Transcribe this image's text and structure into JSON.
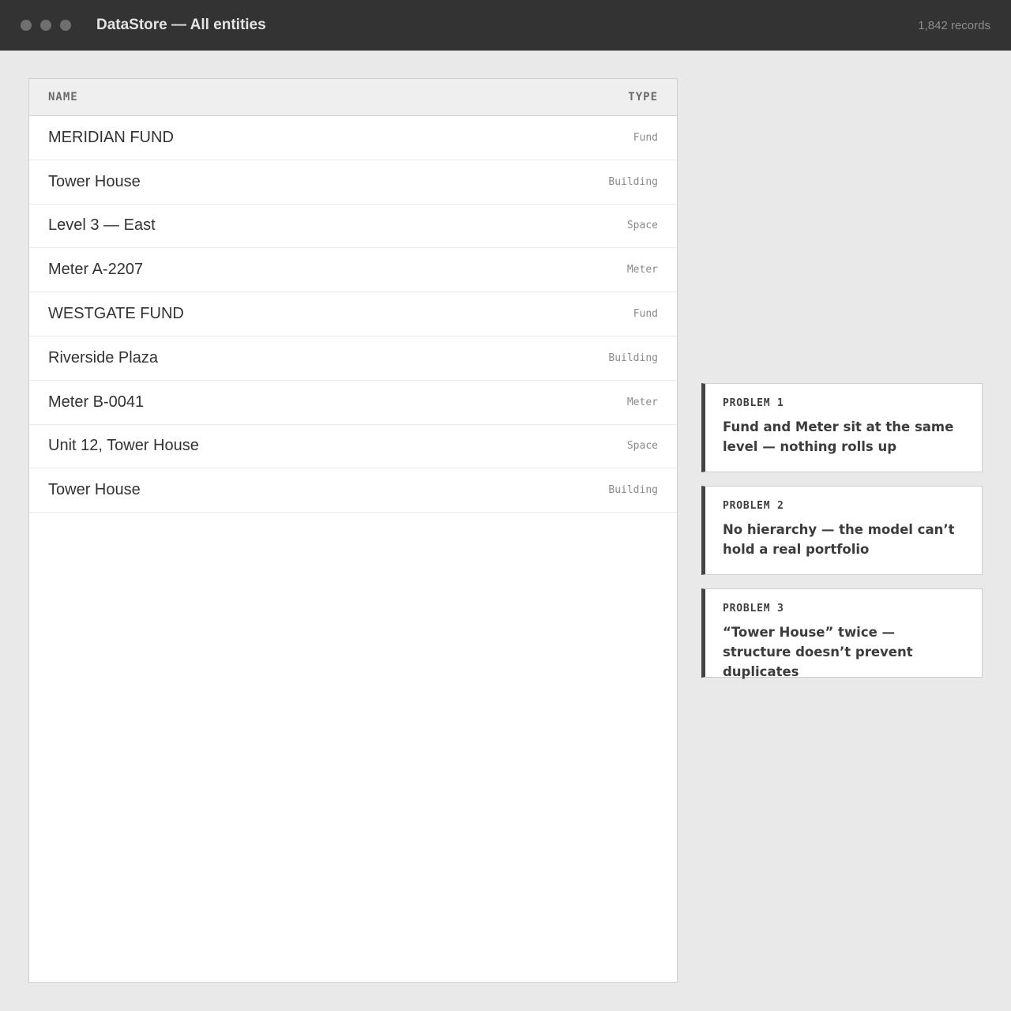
{
  "window": {
    "title": "DataStore — All entities",
    "record_count": "1,842 records",
    "controls": [
      "close-dot",
      "minimize-dot",
      "zoom-dot"
    ]
  },
  "table": {
    "columns": [
      "NAME",
      "TYPE"
    ],
    "rows": [
      {
        "name": "MERIDIAN FUND",
        "type": "Fund"
      },
      {
        "name": "Tower House",
        "type": "Building"
      },
      {
        "name": "Level 3 — East",
        "type": "Space"
      },
      {
        "name": "Meter A-2207",
        "type": "Meter"
      },
      {
        "name": "WESTGATE FUND",
        "type": "Fund"
      },
      {
        "name": "Riverside Plaza",
        "type": "Building"
      },
      {
        "name": "Meter B-0041",
        "type": "Meter"
      },
      {
        "name": "Unit 12, Tower House",
        "type": "Space"
      },
      {
        "name": "Tower House",
        "type": "Building"
      }
    ]
  },
  "problems": [
    {
      "label": "PROBLEM 1",
      "text": "Fund and Meter sit at the same level — nothing rolls up"
    },
    {
      "label": "PROBLEM 2",
      "text": "No hierarchy — the model can’t hold a real portfolio"
    },
    {
      "label": "PROBLEM 3",
      "text": "“Tower House” twice — structure doesn’t prevent duplicates"
    }
  ],
  "colors": {
    "titlebar": "#333333",
    "background": "#e9e9e9",
    "card_accent": "#444444"
  }
}
